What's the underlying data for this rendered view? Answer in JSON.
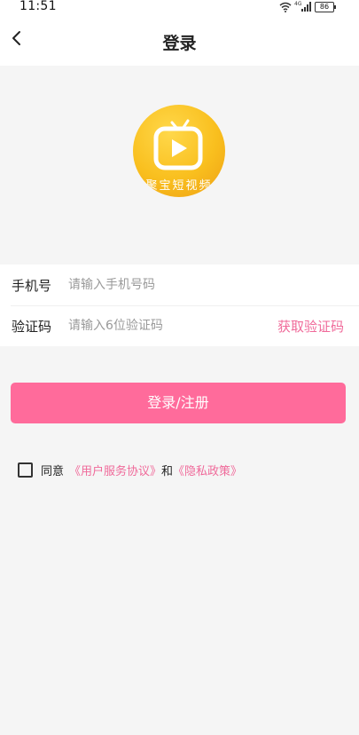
{
  "status_bar": {
    "time": "11:51",
    "network": "4G",
    "battery": "86"
  },
  "nav": {
    "title": "登录"
  },
  "logo": {
    "app_name": "聚宝短视频"
  },
  "form": {
    "phone_label": "手机号",
    "phone_placeholder": "请输入手机号码",
    "code_label": "验证码",
    "code_placeholder": "请输入6位验证码",
    "get_code_label": "获取验证码"
  },
  "submit": {
    "label": "登录/注册"
  },
  "agreement": {
    "prefix": "同意",
    "user_agreement": "《用户服务协议》",
    "conjunction": "和",
    "privacy_policy": "《隐私政策》"
  },
  "colors": {
    "accent": "#ff6b9b",
    "link": "#f06a9a",
    "logo": "#f9bf1e",
    "background": "#f5f5f5"
  }
}
